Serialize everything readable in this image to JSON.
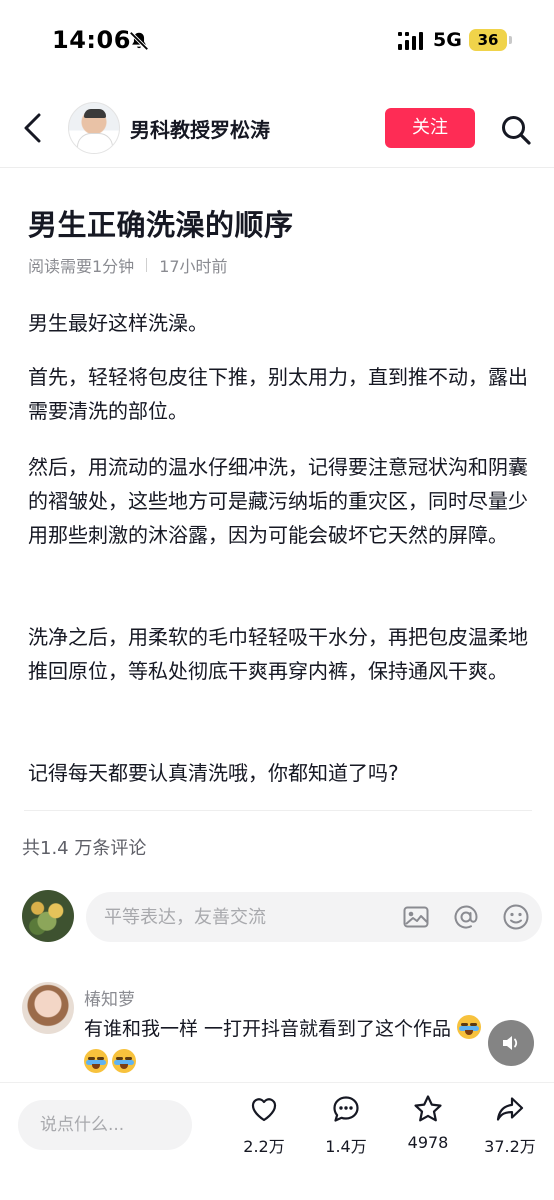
{
  "status_bar": {
    "time": "14:06",
    "network": "5G",
    "battery": "36"
  },
  "header": {
    "author_name": "男科教授罗松涛",
    "follow_label": "关注"
  },
  "article": {
    "title": "男生正确洗澡的顺序",
    "read_time": "阅读需要1分钟",
    "posted": "17小时前",
    "paragraphs": [
      "男生最好这样洗澡。",
      "首先，轻轻将包皮往下推，别太用力，直到推不动，露出需要清洗的部位。",
      "然后，用流动的温水仔细冲洗，记得要注意冠状沟和阴囊的褶皱处，这些地方可是藏污纳垢的重灾区，同时尽量少用那些刺激的沐浴露，因为可能会破坏它天然的屏障。",
      "洗净之后，用柔软的毛巾轻轻吸干水分，再把包皮温柔地推回原位，等私处彻底干爽再穿内裤，保持通风干爽。",
      "记得每天都要认真清洗哦，你都知道了吗?"
    ]
  },
  "comments": {
    "count_label": "共1.4 万条评论",
    "input_placeholder": "平等表达，友善交流",
    "items": [
      {
        "user": "椿知萝",
        "text": "有谁和我一样 一打开抖音就看到了这个作品"
      }
    ]
  },
  "bottom_bar": {
    "say_placeholder": "说点什么...",
    "likes": "2.2万",
    "comments": "1.4万",
    "collects": "4978",
    "shares": "37.2万"
  },
  "colors": {
    "accent": "#fe2c55",
    "battery": "#f0d34a",
    "text_primary": "#161823",
    "text_secondary": "#8a8b91"
  }
}
